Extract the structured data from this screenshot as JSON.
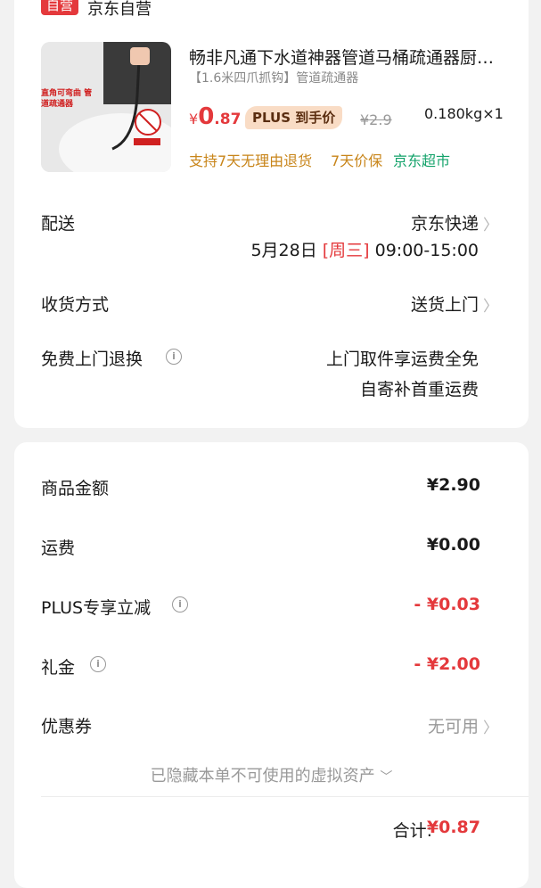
{
  "store": {
    "badge": "自营",
    "name": "京东自营"
  },
  "product": {
    "image_text": "直角可弯曲 管道疏通器",
    "title": "畅非凡通下水道神器管道马桶疏通器厨房下水道疏通工具",
    "spec": "【1.6米四爪抓钩】管道疏通器",
    "price_currency": "¥",
    "price_int": "0",
    "price_dec": ".87",
    "plus_tag": "PLUS 到手价",
    "original_price": "¥2.9",
    "weight_qty": "0.180kg×1",
    "services": [
      "支持7天无理由退货",
      "7天价保",
      "京东超市"
    ]
  },
  "delivery": {
    "label": "配送",
    "carrier": "京东快递",
    "date": "5月28日",
    "weekday": "[周三]",
    "time": "09:00-15:00"
  },
  "receive_method": {
    "label": "收货方式",
    "value": "送货上门"
  },
  "free_return": {
    "label": "免费上门退换",
    "line1": "上门取件享运费全免",
    "line2": "自寄补首重运费"
  },
  "summary": {
    "items": [
      {
        "label": "商品金额",
        "value": "¥2.90"
      },
      {
        "label": "运费",
        "value": "¥0.00"
      },
      {
        "label": "PLUS专享立减",
        "value": "- ¥0.03"
      },
      {
        "label": "礼金",
        "value": "- ¥2.00"
      }
    ],
    "coupon": {
      "label": "优惠券",
      "value": "无可用"
    },
    "hidden_assets": "已隐藏本单不可使用的虚拟资产",
    "total_label": "合计:",
    "total_value": "¥0.87"
  },
  "colors": {
    "accent": "#e4393c",
    "service_orange": "#c8851a",
    "service_green": "#14a36b"
  },
  "icons": [
    "chevron-right-icon",
    "info-icon",
    "chevron-down-icon"
  ]
}
